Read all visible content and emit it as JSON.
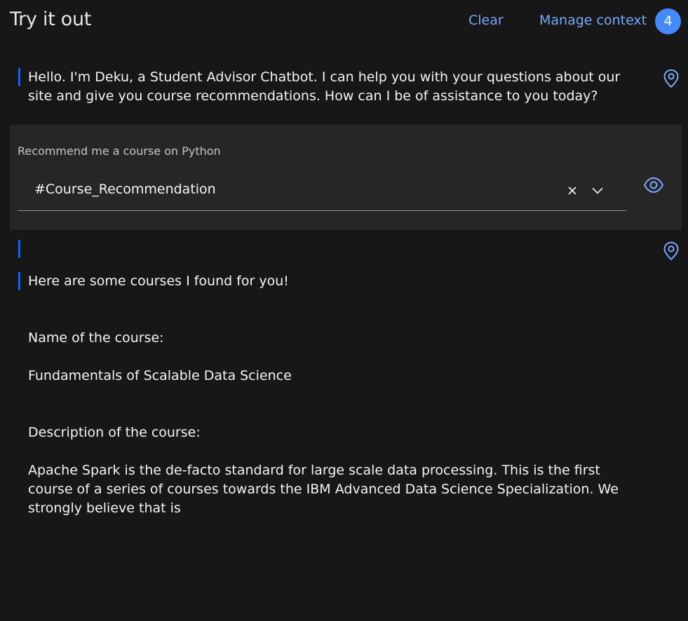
{
  "header": {
    "title": "Try it out",
    "clear_label": "Clear",
    "manage_context_label": "Manage context",
    "context_count": "4"
  },
  "conversation": {
    "bot_greeting": "Hello. I'm Deku, a Student Advisor Chatbot. I can help you with your questions about our\nsite and give you course recommendations. How can I be of assistance to you today?",
    "user_message": "Recommend me a course on Python",
    "detected_intent": "#Course_Recommendation",
    "bot_intro": "Here are some courses I found for you!",
    "course_name_label": "Name of the course:",
    "course_name": "Fundamentals of Scalable Data Science",
    "course_description_label": "Description of the course:",
    "course_description": "Apache Spark is the de-facto standard for large scale data processing. This is the first\ncourse of a series of courses towards the IBM Advanced Data Science Specialization. We\nstrongly believe that is"
  },
  "icons": {
    "location": "location-pin-icon",
    "eye": "eye-icon",
    "clear": "close-icon",
    "dropdown": "chevron-down-icon"
  },
  "colors": {
    "background": "#171717",
    "panel": "#262626",
    "link": "#78a9ff",
    "badge": "#4589ff",
    "accent_bar": "#0f62fe"
  }
}
